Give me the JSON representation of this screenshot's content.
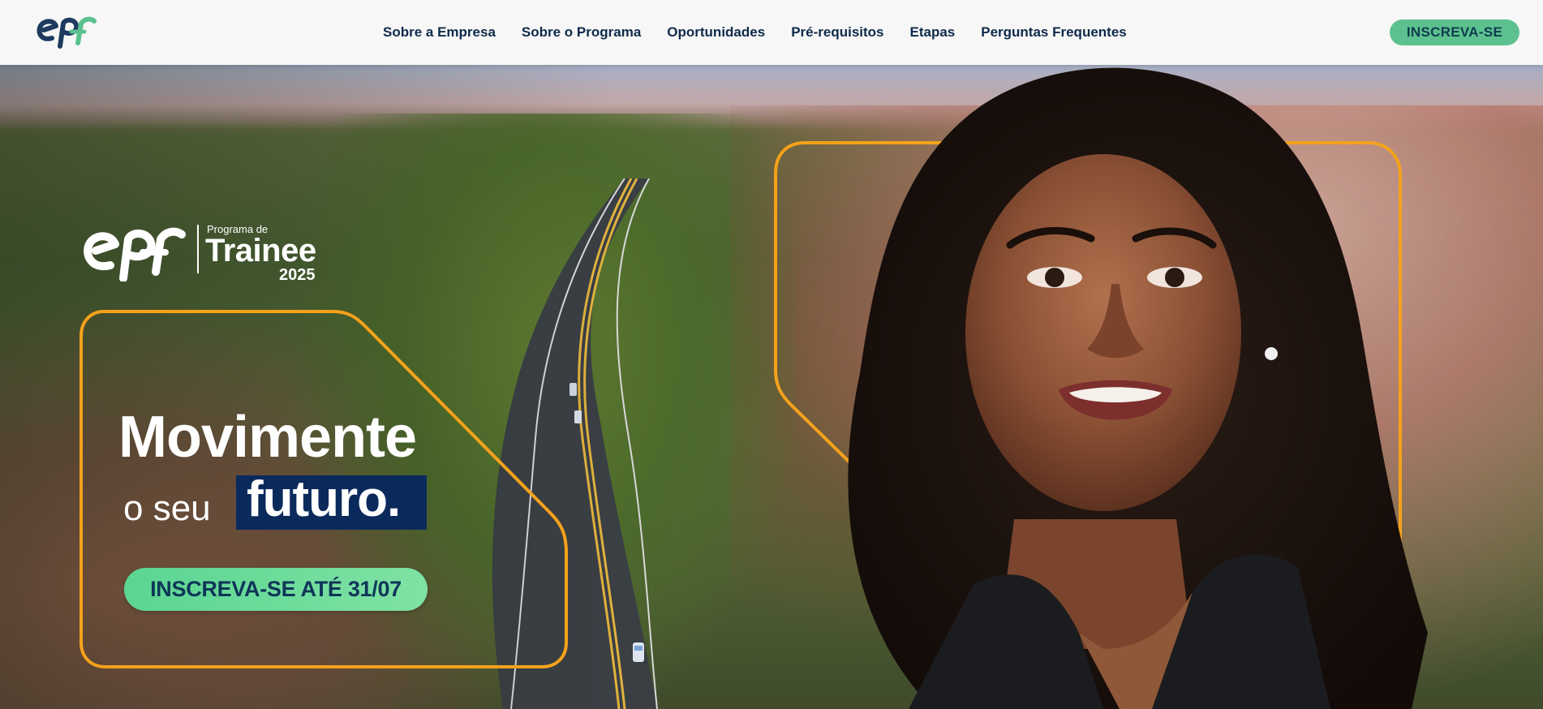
{
  "nav": {
    "links": [
      {
        "label": "Sobre a Empresa"
      },
      {
        "label": "Sobre o Programa"
      },
      {
        "label": "Oportunidades"
      },
      {
        "label": "Pré-requisitos"
      },
      {
        "label": "Etapas"
      },
      {
        "label": "Perguntas Frequentes"
      }
    ],
    "cta_label": "INSCREVA-SE"
  },
  "hero": {
    "program_logo": {
      "kicker": "Programa de",
      "name": "Trainee",
      "year": "2025"
    },
    "headline": "Movimente",
    "subline_prefix": "o seu",
    "subline_highlight": "futuro.",
    "cta_label": "INSCREVA-SE ATÉ 31/07"
  },
  "colors": {
    "accent_green": "#5cc18f",
    "frame_orange": "#f5a21b",
    "navy": "#0b2a5c",
    "logo_teal": "#1e3a5f"
  },
  "icons": {
    "brand_logo": "epr-logo-icon",
    "program_logo": "epr-logo-white-icon"
  }
}
